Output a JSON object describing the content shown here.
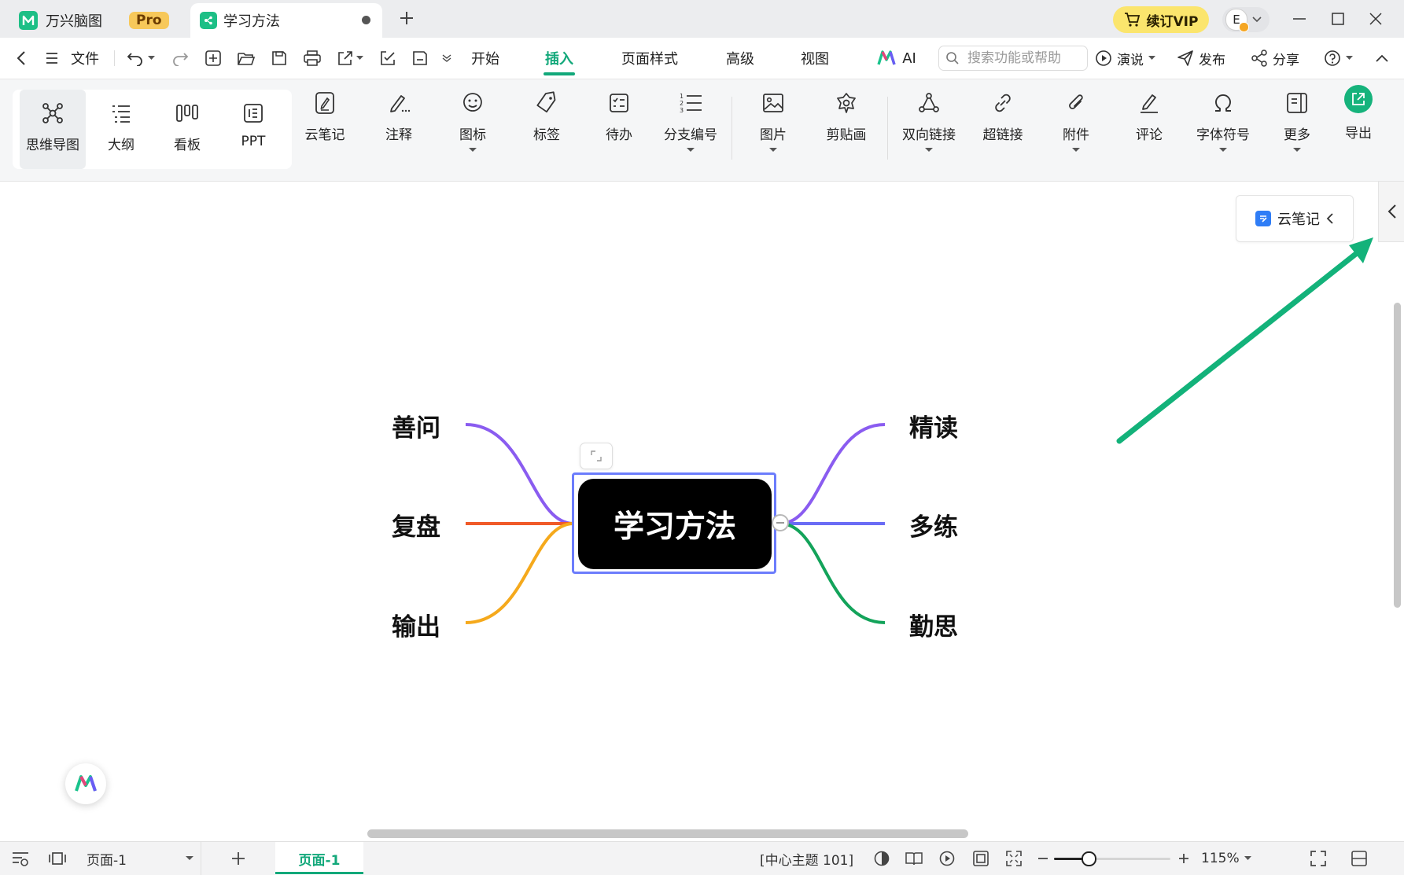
{
  "app": {
    "name": "万兴脑图",
    "badge": "Pro",
    "doc_tab": "学习方法",
    "vip_label": "续订VIP",
    "avatar_initial": "E"
  },
  "menu": {
    "file": "文件",
    "tabs": [
      {
        "label": "开始",
        "active": false
      },
      {
        "label": "插入",
        "active": true
      },
      {
        "label": "页面样式",
        "active": false
      },
      {
        "label": "高级",
        "active": false
      },
      {
        "label": "视图",
        "active": false
      },
      {
        "label": "AI",
        "active": false
      }
    ],
    "search_placeholder": "搜索功能或帮助",
    "present": "演说",
    "publish": "发布",
    "share": "分享"
  },
  "ribbon": {
    "views": [
      {
        "label": "思维导图",
        "icon": "mindmap-icon",
        "selected": true
      },
      {
        "label": "大纲",
        "icon": "outline-icon",
        "selected": false
      },
      {
        "label": "看板",
        "icon": "kanban-icon",
        "selected": false
      },
      {
        "label": "PPT",
        "icon": "ppt-icon",
        "selected": false
      }
    ],
    "tools": [
      {
        "label": "云笔记",
        "icon": "cloud-note-icon",
        "dropdown": false
      },
      {
        "label": "注释",
        "icon": "annotation-pen-icon",
        "dropdown": false
      },
      {
        "label": "图标",
        "icon": "smiley-icon",
        "dropdown": true
      },
      {
        "label": "标签",
        "icon": "tag-icon",
        "dropdown": false
      },
      {
        "label": "待办",
        "icon": "todo-icon",
        "dropdown": false
      },
      {
        "label": "分支编号",
        "icon": "numbered-list-icon",
        "dropdown": true
      },
      {
        "label": "图片",
        "icon": "image-icon",
        "dropdown": true
      },
      {
        "label": "剪贴画",
        "icon": "clipart-flower-icon",
        "dropdown": false
      },
      {
        "label": "双向链接",
        "icon": "bidirectional-link-icon",
        "dropdown": true
      },
      {
        "label": "超链接",
        "icon": "hyperlink-icon",
        "dropdown": false
      },
      {
        "label": "附件",
        "icon": "paperclip-icon",
        "dropdown": true
      },
      {
        "label": "评论",
        "icon": "comment-pen-icon",
        "dropdown": false
      },
      {
        "label": "字体符号",
        "icon": "omega-icon",
        "dropdown": true
      },
      {
        "label": "更多",
        "icon": "more-panel-icon",
        "dropdown": true
      }
    ],
    "export": "导出"
  },
  "mindmap": {
    "central": "学习方法",
    "left": [
      {
        "label": "善问",
        "color": "#8a5cf0"
      },
      {
        "label": "复盘",
        "color": "#f05a28"
      },
      {
        "label": "输出",
        "color": "#f5a91c"
      }
    ],
    "right": [
      {
        "label": "精读",
        "color": "#8a5cf0"
      },
      {
        "label": "多练",
        "color": "#6a6cf5"
      },
      {
        "label": "勤思",
        "color": "#13a35a"
      }
    ]
  },
  "side_panel": {
    "cloud_note_label": "云笔记"
  },
  "annotation_arrow_color": "#13b27a",
  "status": {
    "page_select": "页面-1",
    "page_tab": "页面-1",
    "selection_info": "[中心主题 101]",
    "zoom": "115%",
    "zoom_fraction": 0.3
  },
  "colors": {
    "accent": "#12a87a",
    "selection": "#6c7dfc",
    "vip": "#fbe56d"
  }
}
